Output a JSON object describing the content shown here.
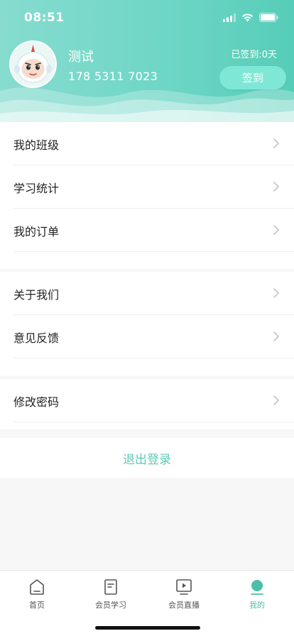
{
  "status_bar": {
    "time": "08:51"
  },
  "profile": {
    "username": "测试",
    "phone": "178 5311 7023",
    "signed_days": "已签到:0天",
    "signin_button": "签到"
  },
  "menu_group1": [
    {
      "label": "我的班级"
    },
    {
      "label": "学习统计"
    },
    {
      "label": "我的订单"
    }
  ],
  "menu_group2": [
    {
      "label": "关于我们"
    },
    {
      "label": "意见反馈"
    }
  ],
  "menu_group3": [
    {
      "label": "修改密码"
    }
  ],
  "logout": "退出登录",
  "tabbar": {
    "items": [
      {
        "label": "首页",
        "icon": "home-icon"
      },
      {
        "label": "会员学习",
        "icon": "book-icon"
      },
      {
        "label": "会员直播",
        "icon": "live-play-icon"
      },
      {
        "label": "我的",
        "icon": "profile-icon"
      }
    ],
    "active": "我的"
  },
  "colors": {
    "accent": "#5dc9b5",
    "header_gradient_start": "#86dccf",
    "header_gradient_end": "#56cdb8",
    "signin_button": "#7fe7d5"
  }
}
